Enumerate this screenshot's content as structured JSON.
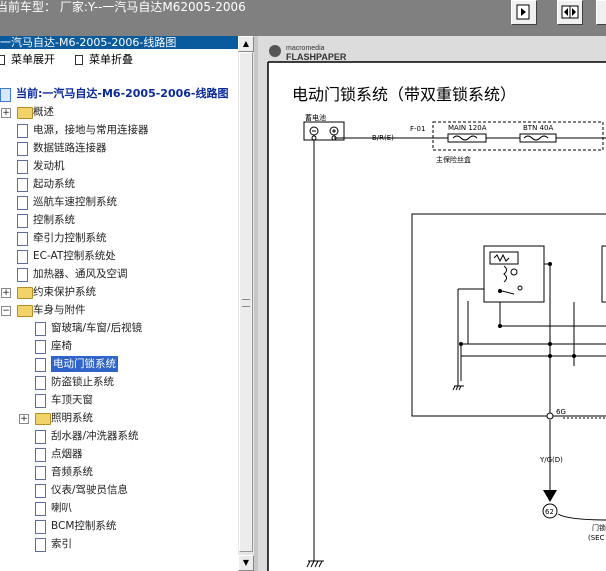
{
  "window": {
    "title": "当前车型：  厂家:Y--一汽马自达M62005-2006"
  },
  "tree": {
    "header": "一汽马自达-M6-2005-2006-线路图",
    "expand_label": "菜单展开",
    "collapse_label": "菜单折叠",
    "current_label": "当前:一汽马自达-M6-2005-2006-线路图",
    "items": [
      {
        "label": "概述",
        "kind": "folder",
        "level": 1,
        "expander": "+"
      },
      {
        "label": "电源，接地与常用连接器",
        "kind": "doc",
        "level": 1
      },
      {
        "label": "数据链路连接器",
        "kind": "doc",
        "level": 1
      },
      {
        "label": "发动机",
        "kind": "doc",
        "level": 1
      },
      {
        "label": "起动系统",
        "kind": "doc",
        "level": 1
      },
      {
        "label": "巡航车速控制系统",
        "kind": "doc",
        "level": 1
      },
      {
        "label": "控制系统",
        "kind": "doc",
        "level": 1
      },
      {
        "label": "牵引力控制系统",
        "kind": "doc",
        "level": 1
      },
      {
        "label": "EC-AT控制系统处",
        "kind": "doc",
        "level": 1
      },
      {
        "label": "加热器、通风及空调",
        "kind": "doc",
        "level": 1
      },
      {
        "label": "约束保护系统",
        "kind": "folder",
        "level": 1,
        "expander": "+"
      },
      {
        "label": "车身与附件",
        "kind": "folder",
        "level": 1,
        "expander": "-"
      },
      {
        "label": "窗玻璃/车窗/后视镜",
        "kind": "doc",
        "level": 2
      },
      {
        "label": "座椅",
        "kind": "doc",
        "level": 2
      },
      {
        "label": "电动门锁系统",
        "kind": "doc",
        "level": 2,
        "selected": true
      },
      {
        "label": "防盗锁止系统",
        "kind": "doc",
        "level": 2
      },
      {
        "label": "车顶天窗",
        "kind": "doc",
        "level": 2
      },
      {
        "label": "照明系统",
        "kind": "folder",
        "level": 2,
        "expander": "+"
      },
      {
        "label": "刮水器/冲洗器系统",
        "kind": "doc",
        "level": 2
      },
      {
        "label": "点烟器",
        "kind": "doc",
        "level": 2
      },
      {
        "label": "音频系统",
        "kind": "doc",
        "level": 2
      },
      {
        "label": "仪表/驾驶员信息",
        "kind": "doc",
        "level": 2
      },
      {
        "label": "喇叭",
        "kind": "doc",
        "level": 2
      },
      {
        "label": "BCM控制系统",
        "kind": "doc",
        "level": 2
      },
      {
        "label": "索引",
        "kind": "doc",
        "level": 2
      }
    ]
  },
  "viewer": {
    "logo_small": "macromedia",
    "logo_big": "FLASHPAPER",
    "doc_title": "电动门锁系统（带双重锁系统）",
    "diagram": {
      "battery_label": "蓄电池",
      "wire1": "B/R(E)",
      "fuse_block_id": "F-01",
      "fuse1": "MAIN 120A",
      "fuse2": "BTN 40A",
      "fuse_box_label": "主保险丝盒",
      "conn_6g": "6G",
      "wire2": "Y/G(D)",
      "conn_62": "62",
      "door_lock": "门锁",
      "sec_label": "(SEC"
    }
  },
  "colors": {
    "chrome": "#808080",
    "tree_header": "#0a5a9e",
    "selection": "#2f65c8"
  }
}
